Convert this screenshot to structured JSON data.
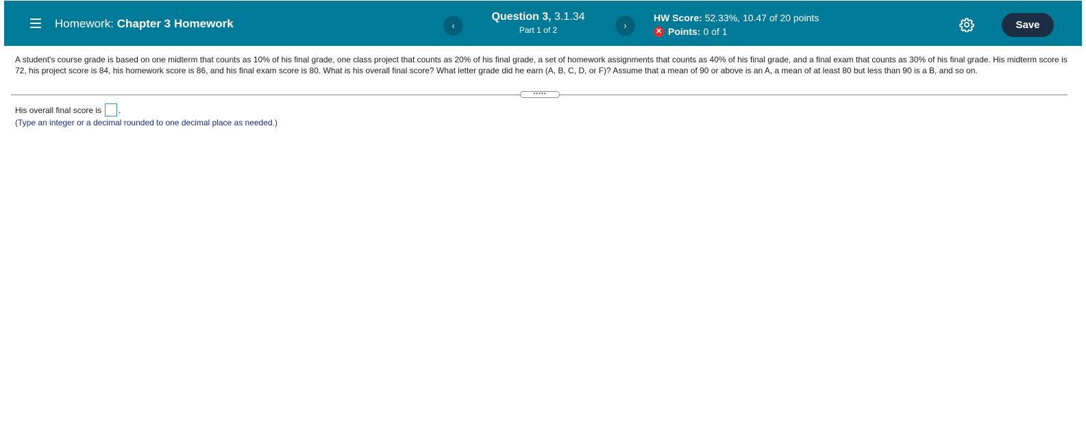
{
  "header": {
    "title_prefix": "Homework:",
    "title_name": "Chapter 3 Homework",
    "prev_label": "‹",
    "next_label": "›",
    "question_label": "Question 3,",
    "question_id": "3.1.34",
    "part_label": "Part 1 of 2",
    "hw_score_label": "HW Score:",
    "hw_score_value": "52.33%, 10.47 of 20 points",
    "points_label": "Points:",
    "points_value": "0 of 1",
    "save_label": "Save"
  },
  "question": {
    "text": "A student's course grade is based on one midterm that counts as 10% of his final grade, one class project that counts as 20% of his final grade, a set of homework assignments that counts as 40% of his final grade, and a final exam that counts as 30% of his final grade. His midterm score is 72, his project score is 84, his homework score is 86, and his final exam score is 80. What is his overall final score? What letter grade did he earn (A, B, C, D, or F)? Assume that a mean of 90 or above is an A, a mean of at least 80 but less than 90 is a B, and so on."
  },
  "divider": {
    "handle_label": "•••••"
  },
  "answer": {
    "prompt": "His overall final score is",
    "suffix": ".",
    "hint": "(Type an integer or a decimal rounded to one decimal place as needed.)"
  },
  "colors": {
    "header_bg": "#007a99",
    "save_bg": "#1d2d44",
    "error_red": "#e02b2b",
    "hint_color": "#1a2a8c"
  },
  "icons": {
    "menu": "menu-icon",
    "prev": "chevron-left-icon",
    "next": "chevron-right-icon",
    "incorrect": "x-circle-icon",
    "settings": "gear-icon"
  }
}
